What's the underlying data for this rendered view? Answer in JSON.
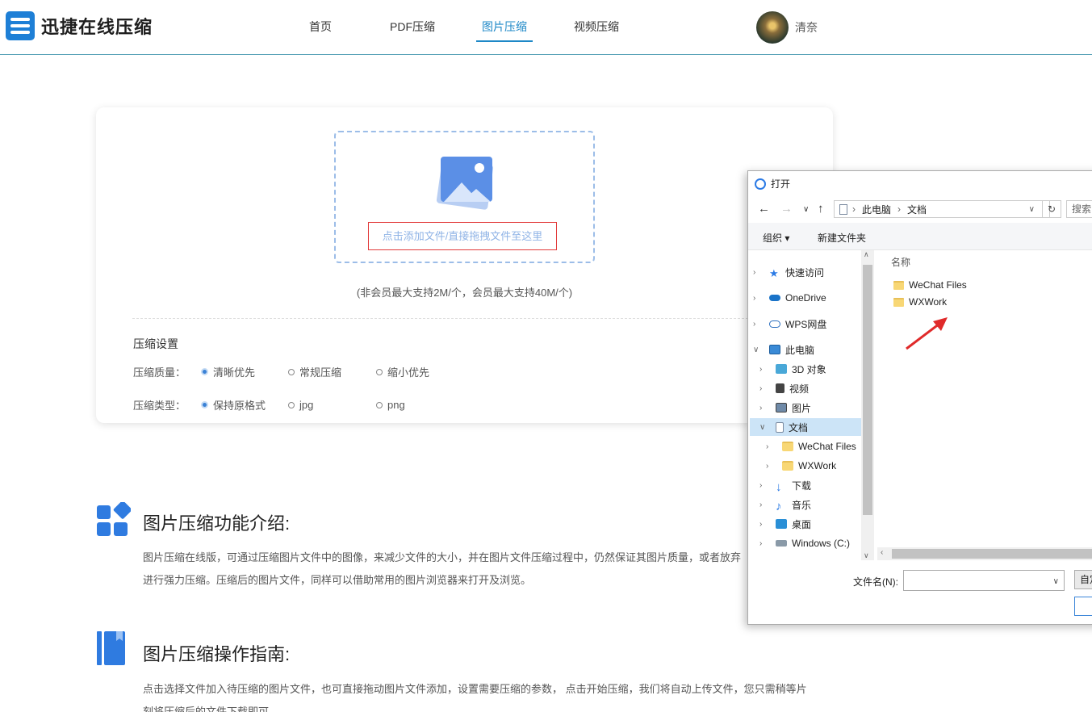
{
  "header": {
    "brand": "迅捷在线压缩",
    "nav": [
      "首页",
      "PDF压缩",
      "图片压缩",
      "视频压缩"
    ],
    "active_nav": "图片压缩",
    "user_name": "清奈"
  },
  "upload": {
    "add_file_label": "点击添加文件/直接拖拽文件至这里",
    "limit_note": "(非会员最大支持2M/个，会员最大支持40M/个)"
  },
  "settings": {
    "title": "压缩设置",
    "quality_label": "压缩质量：",
    "quality_options": [
      "清晰优先",
      "常规压缩",
      "缩小优先"
    ],
    "type_label": "压缩类型：",
    "type_options": [
      "保持原格式",
      "jpg",
      "png"
    ]
  },
  "intro": {
    "title": "图片压缩功能介绍:",
    "line1": "图片压缩在线版，可通过压缩图片文件中的图像，来减少文件的大小，并在图片文件压缩过程中，仍然保证其图片质量，或者放弃",
    "line2": "进行强力压缩。压缩后的图片文件，同样可以借助常用的图片浏览器来打开及浏览。"
  },
  "guide": {
    "title": "图片压缩操作指南:",
    "line1": "点击选择文件加入待压缩的图片文件，也可直接拖动图片文件添加，设置需要压缩的参数， 点击开始压缩，我们将自动上传文件，您只需稍等片",
    "line2": "刻将压缩后的文件下载即可"
  },
  "dialog": {
    "title": "打开",
    "breadcrumb": [
      "此电脑",
      "文档"
    ],
    "search_placeholder": "搜索",
    "toolbar": {
      "organize": "组织 ▾",
      "new_folder": "新建文件夹"
    },
    "tree": [
      "快速访问",
      "OneDrive",
      "WPS网盘",
      "此电脑",
      "3D 对象",
      "视频",
      "图片",
      "文档",
      "WeChat Files",
      "WXWork",
      "下载",
      "音乐",
      "桌面",
      "Windows (C:)"
    ],
    "list_header": "名称",
    "files": [
      "WeChat Files",
      "WXWork"
    ],
    "filename_label": "文件名(N):",
    "filename_value": "",
    "btn_custom": "自定",
    "btn_open": ""
  },
  "colors": {
    "accent": "#1e88c7",
    "highlight_box": "#e23b3b",
    "arrow": "#e02a2a"
  }
}
